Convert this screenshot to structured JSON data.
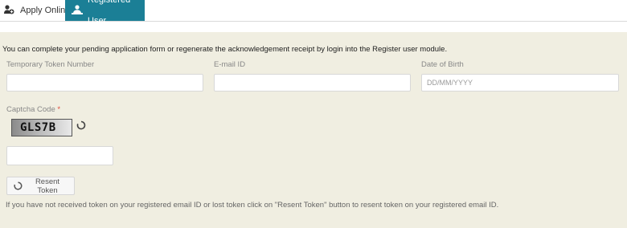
{
  "tabs": [
    {
      "label": "Apply Online",
      "icon": "user-add-icon",
      "active": false
    },
    {
      "label": "Registered User",
      "icon": "registered-user-icon",
      "active": true
    }
  ],
  "intro_text": "You can complete your pending application form or regenerate the acknowledgement receipt by login into the Register user module.",
  "form": {
    "token_label": "Temporary Token Number",
    "token_value": "",
    "email_label": "E-mail ID",
    "email_value": "",
    "dob_label": "Date of Birth",
    "dob_placeholder": "DD/MM/YYYY",
    "captcha_label": "Captcha Code",
    "captcha_required_mark": "*",
    "captcha_text": "GLS7B",
    "captcha_input_value": ""
  },
  "resend_button_label": "Resent Token",
  "help_text": "If you have not received token on your registered email ID or lost token click on \"Resent Token\" button to resent token on your registered email ID.",
  "colors": {
    "active_tab": "#1b7f96",
    "panel_background": "#f0eee1",
    "required_mark": "#e04b3b"
  }
}
